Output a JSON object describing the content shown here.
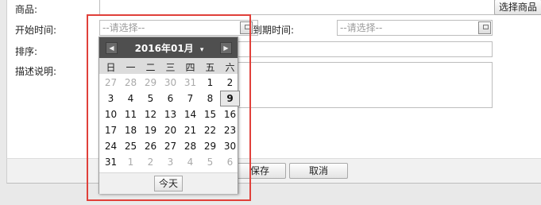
{
  "form": {
    "product_label": "商品:",
    "start_label": "开始时间:",
    "end_label": "到期时间:",
    "sort_label": "排序:",
    "desc_label": "描述说明:",
    "start_placeholder": "--请选择--",
    "end_placeholder": "--请选择--",
    "select_product_button": "选择商品",
    "save_button": "保存",
    "cancel_button": "取消"
  },
  "calendar": {
    "title": "2016年01月",
    "title_dropdown_glyph": "▾",
    "prev_glyph": "◀",
    "next_glyph": "▶",
    "weekdays": [
      "日",
      "一",
      "二",
      "三",
      "四",
      "五",
      "六"
    ],
    "weeks": [
      [
        {
          "d": "27",
          "o": true
        },
        {
          "d": "28",
          "o": true
        },
        {
          "d": "29",
          "o": true
        },
        {
          "d": "30",
          "o": true
        },
        {
          "d": "31",
          "o": true
        },
        {
          "d": "1",
          "o": false
        },
        {
          "d": "2",
          "o": false
        }
      ],
      [
        {
          "d": "3",
          "o": false
        },
        {
          "d": "4",
          "o": false
        },
        {
          "d": "5",
          "o": false
        },
        {
          "d": "6",
          "o": false
        },
        {
          "d": "7",
          "o": false
        },
        {
          "d": "8",
          "o": false
        },
        {
          "d": "9",
          "o": false,
          "today": true
        }
      ],
      [
        {
          "d": "10",
          "o": false
        },
        {
          "d": "11",
          "o": false
        },
        {
          "d": "12",
          "o": false
        },
        {
          "d": "13",
          "o": false
        },
        {
          "d": "14",
          "o": false
        },
        {
          "d": "15",
          "o": false
        },
        {
          "d": "16",
          "o": false
        }
      ],
      [
        {
          "d": "17",
          "o": false
        },
        {
          "d": "18",
          "o": false
        },
        {
          "d": "19",
          "o": false
        },
        {
          "d": "20",
          "o": false
        },
        {
          "d": "21",
          "o": false
        },
        {
          "d": "22",
          "o": false
        },
        {
          "d": "23",
          "o": false
        }
      ],
      [
        {
          "d": "24",
          "o": false
        },
        {
          "d": "25",
          "o": false
        },
        {
          "d": "26",
          "o": false
        },
        {
          "d": "27",
          "o": false
        },
        {
          "d": "28",
          "o": false
        },
        {
          "d": "29",
          "o": false
        },
        {
          "d": "30",
          "o": false
        }
      ],
      [
        {
          "d": "31",
          "o": false
        },
        {
          "d": "1",
          "o": true
        },
        {
          "d": "2",
          "o": true
        },
        {
          "d": "3",
          "o": true
        },
        {
          "d": "4",
          "o": true
        },
        {
          "d": "5",
          "o": true
        },
        {
          "d": "6",
          "o": true
        }
      ]
    ],
    "today_button": "今天"
  },
  "colors": {
    "highlight": "#e0403a",
    "header": "#4f4f4f"
  }
}
